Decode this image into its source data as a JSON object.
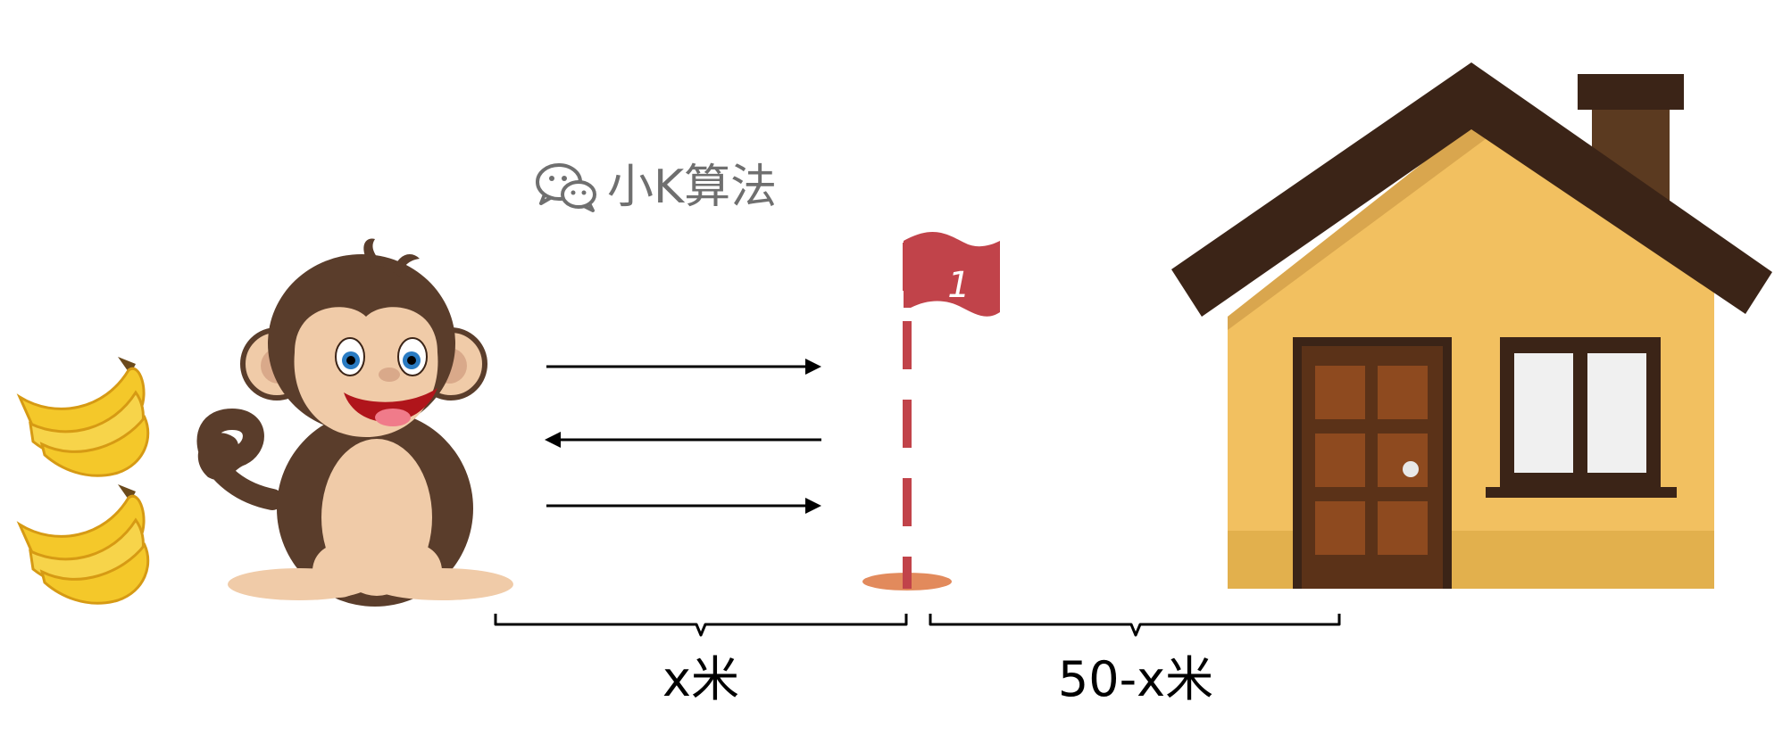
{
  "watermark": {
    "text": "小K算法",
    "icon": "wechat-icon",
    "color": "#6f6f6f"
  },
  "flag": {
    "number": "1",
    "color": "#c1434a"
  },
  "segments": [
    {
      "label": "x米"
    },
    {
      "label": "50-x米"
    }
  ],
  "arrows": [
    "right",
    "left",
    "right"
  ],
  "colors": {
    "house_wall": "#f2c060",
    "roof": "#3b2417",
    "door": "#5b3218",
    "door_panel": "#8e4a1f",
    "banana": "#f4c82a",
    "monkey_fur": "#5a3d2b",
    "monkey_skin": "#f0cba8",
    "hole": "#e28a5c"
  }
}
